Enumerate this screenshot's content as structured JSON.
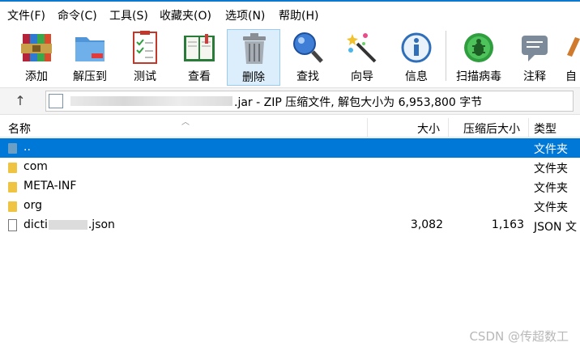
{
  "menu": [
    "文件(F)",
    "命令(C)",
    "工具(S)",
    "收藏夹(O)",
    "选项(N)",
    "帮助(H)"
  ],
  "toolbar": [
    {
      "label": "添加",
      "icon": "winrar-books-icon"
    },
    {
      "label": "解压到",
      "icon": "folder-extract-icon"
    },
    {
      "label": "测试",
      "icon": "checklist-icon"
    },
    {
      "label": "查看",
      "icon": "open-book-icon"
    },
    {
      "label": "删除",
      "icon": "trash-can-icon"
    },
    {
      "label": "查找",
      "icon": "magnifier-icon"
    },
    {
      "label": "向导",
      "icon": "magic-wand-icon"
    },
    {
      "label": "信息",
      "icon": "info-icon"
    },
    {
      "label": "扫描病毒",
      "icon": "virus-scan-bug-icon"
    },
    {
      "label": "注释",
      "icon": "comment-icon"
    },
    {
      "label": "自",
      "icon": "sfx-icon"
    }
  ],
  "address": {
    "text": ".jar - ZIP 压缩文件, 解包大小为 6,953,800 字节"
  },
  "columns": {
    "name": "名称",
    "size": "大小",
    "packed": "压缩后大小",
    "type": "类型"
  },
  "rows": [
    {
      "name": "..",
      "size": "",
      "packed": "",
      "type": "文件夹",
      "selected": true
    },
    {
      "name": "com",
      "size": "",
      "packed": "",
      "type": "文件夹"
    },
    {
      "name": "META-INF",
      "size": "",
      "packed": "",
      "type": "文件夹"
    },
    {
      "name": "org",
      "size": "",
      "packed": "",
      "type": "文件夹"
    },
    {
      "name_prefix": "dicti",
      "name_suffix": ".json",
      "size": "3,082",
      "packed": "1,163",
      "type": "JSON 文"
    }
  ],
  "watermark": "CSDN @传超数工",
  "colors": {
    "selection": "#0078d7",
    "accent": "#0b79d0",
    "folder": "#f0c443"
  }
}
